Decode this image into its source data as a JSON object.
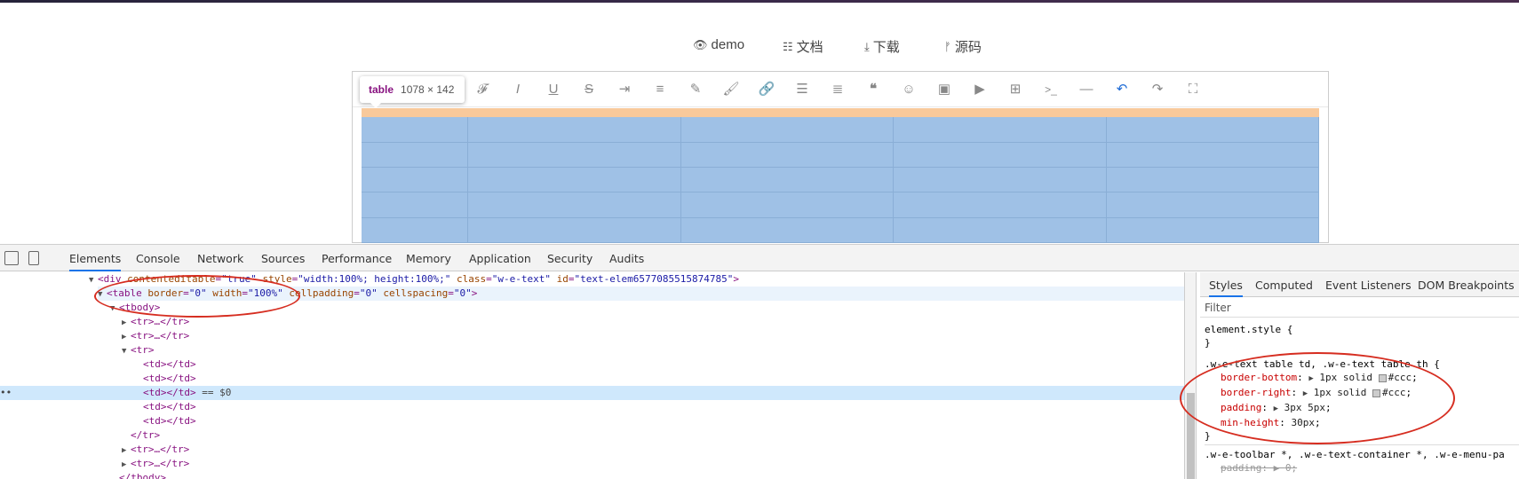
{
  "nav": {
    "demo": "demo",
    "docs": "文档",
    "download": "下载",
    "source": "源码"
  },
  "tooltip": {
    "tag": "table",
    "dims": "1078 × 142"
  },
  "editor": {
    "toolbar_icons": [
      "font-icon",
      "italic-icon",
      "underline-icon",
      "strikethrough-icon",
      "indent-icon",
      "line-height-icon",
      "fore-color-icon",
      "back-color-icon",
      "link-icon",
      "list-icon",
      "justify-icon",
      "quote-icon",
      "emoticon-icon",
      "image-icon",
      "video-icon",
      "table-icon",
      "code-icon",
      "splitline-icon",
      "undo-icon",
      "redo-icon",
      "fullscreen-icon"
    ],
    "table": {
      "rows": 5,
      "cols": 5
    }
  },
  "devtools": {
    "tabs": [
      "Elements",
      "Console",
      "Network",
      "Sources",
      "Performance",
      "Memory",
      "Application",
      "Security",
      "Audits"
    ],
    "dom": {
      "line1_tag_open": "<div ",
      "line1_attr1": "contenteditable",
      "line1_val1": "\"true\"",
      "line1_attr2": " style",
      "line1_val2": "\"width:100%; height:100%;\"",
      "line1_attr3": " class",
      "line1_val3": "\"w-e-text\"",
      "line1_attr4": " id",
      "line1_val4": "\"text-elem6577085515874785\"",
      "line1_close": ">",
      "table_open": "<table ",
      "table_attr1": "border",
      "table_val1": "\"0\"",
      "table_attr2": " width",
      "table_val2": "\"100%\"",
      "table_attr3": " cellpadding",
      "table_val3": "\"0\"",
      "table_attr4": " cellspacing",
      "table_val4": "\"0\"",
      "table_close": ">",
      "tbody": "<tbody>",
      "tr_collapsed": "<tr>…</tr>",
      "tr_open": "<tr>",
      "td": "<td></td>",
      "selected_suffix": " == $0",
      "tr_close": "</tr>",
      "tbody_close": "</tbody>"
    },
    "styles_tabs": [
      "Styles",
      "Computed",
      "Event Listeners",
      "DOM Breakpoints"
    ],
    "filter_placeholder": "Filter",
    "element_style": "element.style {",
    "close_brace": "}",
    "rule_selector": ".w-e-text table td, .w-e-text table th {",
    "props": [
      {
        "name": "border-bottom",
        "value": "1px solid",
        "color": "#ccc"
      },
      {
        "name": "border-right",
        "value": "1px solid",
        "color": "#ccc"
      },
      {
        "name": "padding",
        "value": "3px 5px"
      },
      {
        "name": "min-height",
        "value": "30px"
      }
    ],
    "rule2_selector": ".w-e-toolbar *, .w-e-text-container *, .w-e-menu-pa",
    "rule2_prop": "padding",
    "rule2_val": "0"
  }
}
